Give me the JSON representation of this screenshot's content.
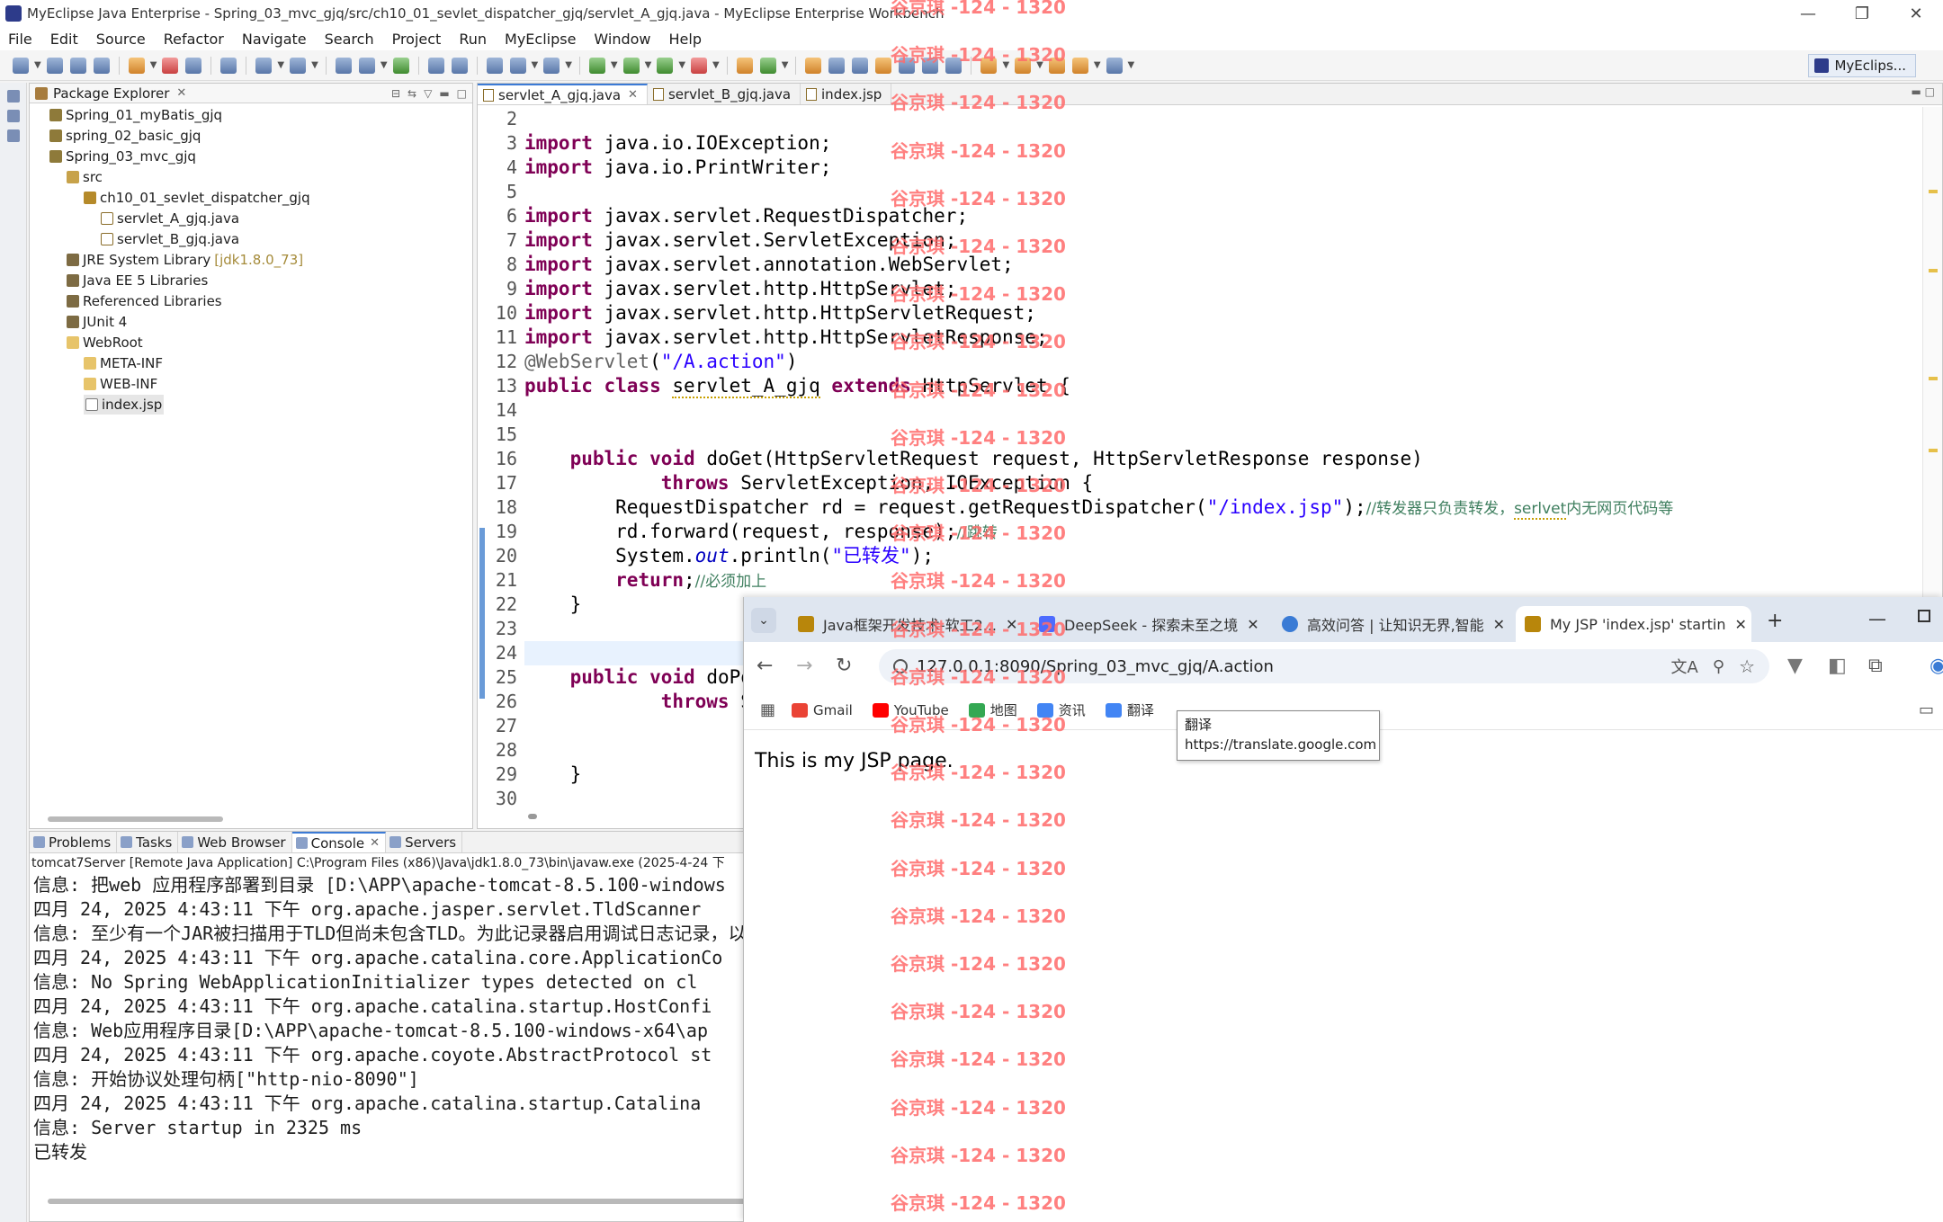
{
  "window": {
    "title": "MyEclipse Java Enterprise - Spring_03_mvc_gjq/src/ch10_01_sevlet_dispatcher_gjq/servlet_A_gjq.java - MyEclipse Enterprise Workbench",
    "minimize": "—",
    "maximize": "❐",
    "close": "✕"
  },
  "menu": [
    "File",
    "Edit",
    "Source",
    "Refactor",
    "Navigate",
    "Search",
    "Project",
    "Run",
    "MyEclipse",
    "Window",
    "Help"
  ],
  "perspective": "MyEclips...",
  "package_explorer": {
    "title": "Package Explorer",
    "tree": [
      {
        "label": "Spring_01_myBatis_gjq",
        "icon": "project-icon",
        "depth": 0
      },
      {
        "label": "spring_02_basic_gjq",
        "icon": "project-icon",
        "depth": 0
      },
      {
        "label": "Spring_03_mvc_gjq",
        "icon": "project-icon",
        "depth": 0
      },
      {
        "label": "src",
        "icon": "source-folder-icon",
        "depth": 1
      },
      {
        "label": "ch10_01_sevlet_dispatcher_gjq",
        "icon": "package-icon",
        "depth": 2
      },
      {
        "label": "servlet_A_gjq.java",
        "icon": "java-file-icon",
        "depth": 3
      },
      {
        "label": "servlet_B_gjq.java",
        "icon": "java-file-icon",
        "depth": 3
      },
      {
        "label": "JRE System Library",
        "extra": "[jdk1.8.0_73]",
        "icon": "library-icon",
        "depth": 1
      },
      {
        "label": "Java EE 5 Libraries",
        "icon": "library-icon",
        "depth": 1
      },
      {
        "label": "Referenced Libraries",
        "icon": "library-icon",
        "depth": 1
      },
      {
        "label": "JUnit 4",
        "icon": "library-icon",
        "depth": 1
      },
      {
        "label": "WebRoot",
        "icon": "folder-icon",
        "depth": 1
      },
      {
        "label": "META-INF",
        "icon": "folder-icon",
        "depth": 2
      },
      {
        "label": "WEB-INF",
        "icon": "folder-icon",
        "depth": 2
      },
      {
        "label": "index.jsp",
        "icon": "jsp-file-icon",
        "depth": 2,
        "selected": true
      }
    ]
  },
  "editor": {
    "tabs": [
      {
        "label": "servlet_A_gjq.java",
        "active": true
      },
      {
        "label": "servlet_B_gjq.java",
        "active": false
      },
      {
        "label": "index.jsp",
        "active": false
      }
    ],
    "line_numbers": [
      "2",
      "3",
      "4",
      "5",
      "6",
      "7",
      "8",
      "9",
      "10",
      "11",
      "12",
      "13",
      "14",
      "15",
      "16",
      "17",
      "18",
      "19",
      "20",
      "21",
      "22",
      "23",
      "24",
      "25",
      "26",
      "27",
      "28",
      "29",
      "30"
    ],
    "current_line": "21"
  },
  "console": {
    "tabs": [
      "Problems",
      "Tasks",
      "Web Browser",
      "Console",
      "Servers"
    ],
    "header": "tomcat7Server [Remote Java Application] C:\\Program Files (x86)\\Java\\jdk1.8.0_73\\bin\\javaw.exe (2025-4-24 下",
    "lines": [
      "信息: 把web 应用程序部署到目录 [D:\\APP\\apache-tomcat-8.5.100-windows",
      "四月 24, 2025 4:43:11 下午 org.apache.jasper.servlet.TldScanner",
      "信息: 至少有一个JAR被扫描用于TLD但尚未包含TLD。为此记录器启用调试日志记录，以获",
      "四月 24, 2025 4:43:11 下午 org.apache.catalina.core.ApplicationCo",
      "信息: No Spring WebApplicationInitializer types detected on cl",
      "四月 24, 2025 4:43:11 下午 org.apache.catalina.startup.HostConfi",
      "信息: Web应用程序目录[D:\\APP\\apache-tomcat-8.5.100-windows-x64\\ap",
      "四月 24, 2025 4:43:11 下午 org.apache.coyote.AbstractProtocol st",
      "信息: 开始协议处理句柄[\"http-nio-8090\"]",
      "四月 24, 2025 4:43:11 下午 org.apache.catalina.startup.Catalina",
      "信息: Server startup in 2325 ms",
      "已转发"
    ]
  },
  "browser": {
    "tabs": [
      {
        "label": "Java框架开发技术-软工2..."
      },
      {
        "label": "DeepSeek - 探索未至之境"
      },
      {
        "label": "高效问答 | 让知识无界,智能"
      },
      {
        "label": "My JSP 'index.jsp' startin",
        "active": true
      }
    ],
    "url": "127.0.0.1:8090/Spring_03_mvc_gjq/A.action",
    "bookmarks": [
      "Gmail",
      "YouTube",
      "地图",
      "资讯",
      "翻译"
    ],
    "tooltip_title": "翻译",
    "tooltip_url": "https://translate.google.com",
    "page_text": "This is my JSP page."
  },
  "watermark": "谷京琪 -124 - 1320",
  "colors": {
    "keyword": "#7f0055",
    "string": "#2a00ff",
    "comment": "#3f7f5f",
    "watermark": "#ff6b6b"
  }
}
